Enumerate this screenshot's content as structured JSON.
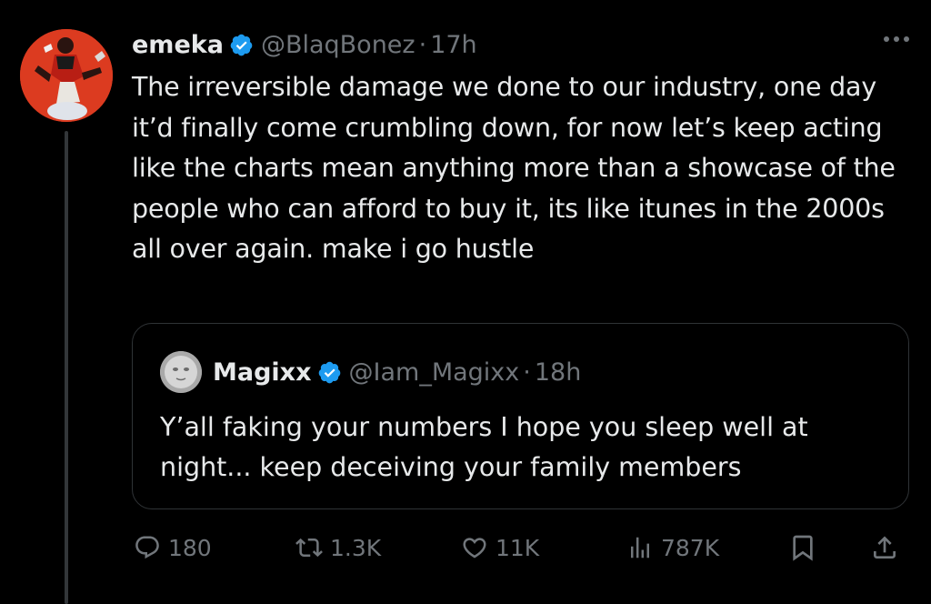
{
  "tweet": {
    "display_name": "emeka",
    "handle": "@BlaqBonez",
    "separator": "·",
    "time": "17h",
    "verified": true,
    "avatar_color": "#dc3b20",
    "text": "The irreversible damage we done to our industry, one day it’d finally come crumbling down, for now let’s keep acting like the charts mean anything more than a showcase of the people who can afford to buy it, its like itunes in the 2000s all over again. make i go hustle"
  },
  "quote": {
    "display_name": "Magixx",
    "handle": "@Iam_Magixx",
    "separator": "·",
    "time": "18h",
    "verified": true,
    "text": "Y’all faking your numbers I hope you sleep well at night... keep deceiving your family members"
  },
  "actions": {
    "replies": "180",
    "retweets": "1.3K",
    "likes": "11K",
    "views": "787K"
  },
  "icons": {
    "verified": "verified-badge-icon",
    "more": "more-horizontal-icon",
    "reply": "reply-bubble-icon",
    "retweet": "retweet-icon",
    "like": "heart-icon",
    "views": "views-bar-icon",
    "bookmark": "bookmark-icon",
    "share": "share-upload-icon"
  },
  "colors": {
    "background": "#000000",
    "text": "#e7e9ea",
    "secondary": "#71767b",
    "verified": "#1d9bf0",
    "border": "#2f3336"
  }
}
